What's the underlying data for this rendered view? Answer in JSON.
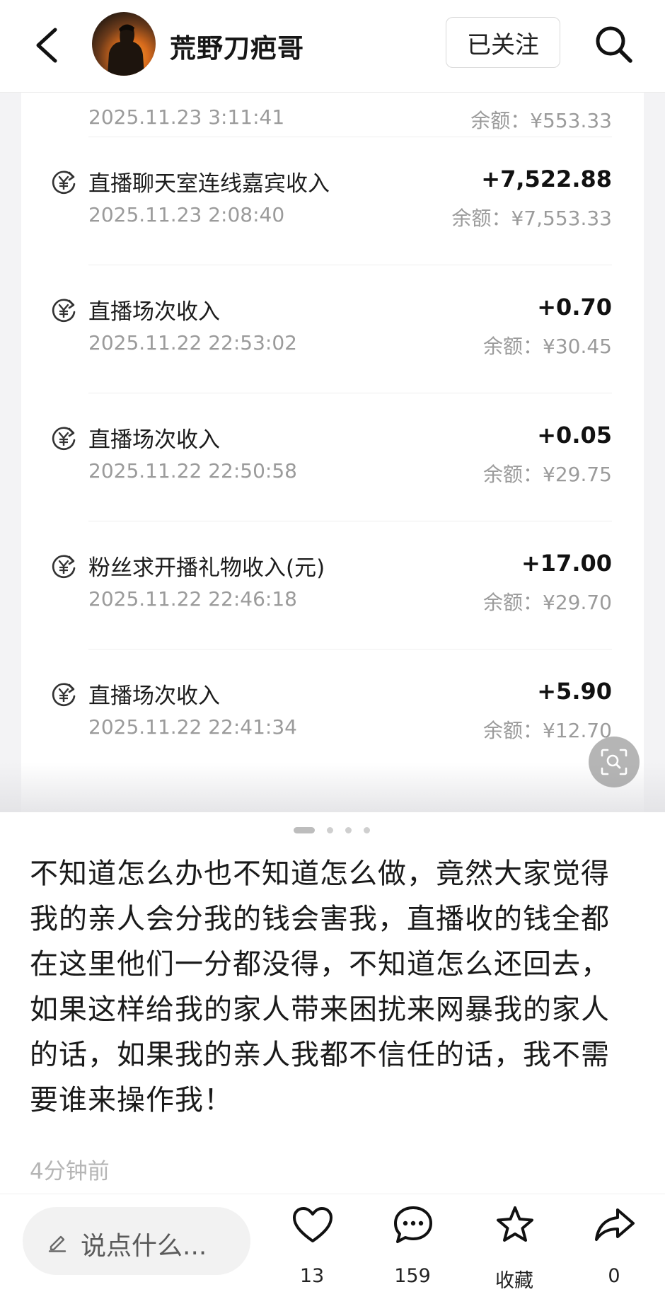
{
  "header": {
    "username": "荒野刀疤哥",
    "follow_label": "已关注"
  },
  "transactions": [
    {
      "title": "",
      "amount": "",
      "time": "2025.11.23 3:11:41",
      "balance": "余额：¥553.33"
    },
    {
      "title": "直播聊天室连线嘉宾收入",
      "amount": "+7,522.88",
      "time": "2025.11.23 2:08:40",
      "balance": "余额：¥7,553.33"
    },
    {
      "title": "直播场次收入",
      "amount": "+0.70",
      "time": "2025.11.22 22:53:02",
      "balance": "余额：¥30.45"
    },
    {
      "title": "直播场次收入",
      "amount": "+0.05",
      "time": "2025.11.22 22:50:58",
      "balance": "余额：¥29.75"
    },
    {
      "title": "粉丝求开播礼物收入(元)",
      "amount": "+17.00",
      "time": "2025.11.22 22:46:18",
      "balance": "余额：¥29.70"
    },
    {
      "title": "直播场次收入",
      "amount": "+5.90",
      "time": "2025.11.22 22:41:34",
      "balance": "余额：¥12.70"
    }
  ],
  "pager": {
    "count": 4,
    "active_index": 0
  },
  "post": {
    "text": "不知道怎么办也不知道怎么做，竟然大家觉得我的亲人会分我的钱会害我，直播收的钱全都在这里他们一分都没得，不知道怎么还回去，如果这样给我的家人带来困扰来网暴我的家人的话，如果我的亲人我都不信任的话，我不需要谁来操作我！",
    "time": "4分钟前"
  },
  "bottom_bar": {
    "comment_placeholder": "说点什么...",
    "like_count": "13",
    "comment_count": "159",
    "collect_label": "收藏",
    "share_count": "0"
  },
  "icons": {
    "back": "chevron-left-icon",
    "search": "search-icon",
    "income": "yuan-income-icon",
    "lens": "image-search-icon",
    "like": "heart-icon",
    "comment": "chat-bubble-icon",
    "collect": "star-icon",
    "share": "share-arrow-icon",
    "edit": "pencil-icon"
  },
  "colors": {
    "text_primary": "#1a1a1a",
    "text_secondary": "#9b9b9b",
    "timestamp": "#b5b5b5",
    "divider": "#eeeeee"
  }
}
